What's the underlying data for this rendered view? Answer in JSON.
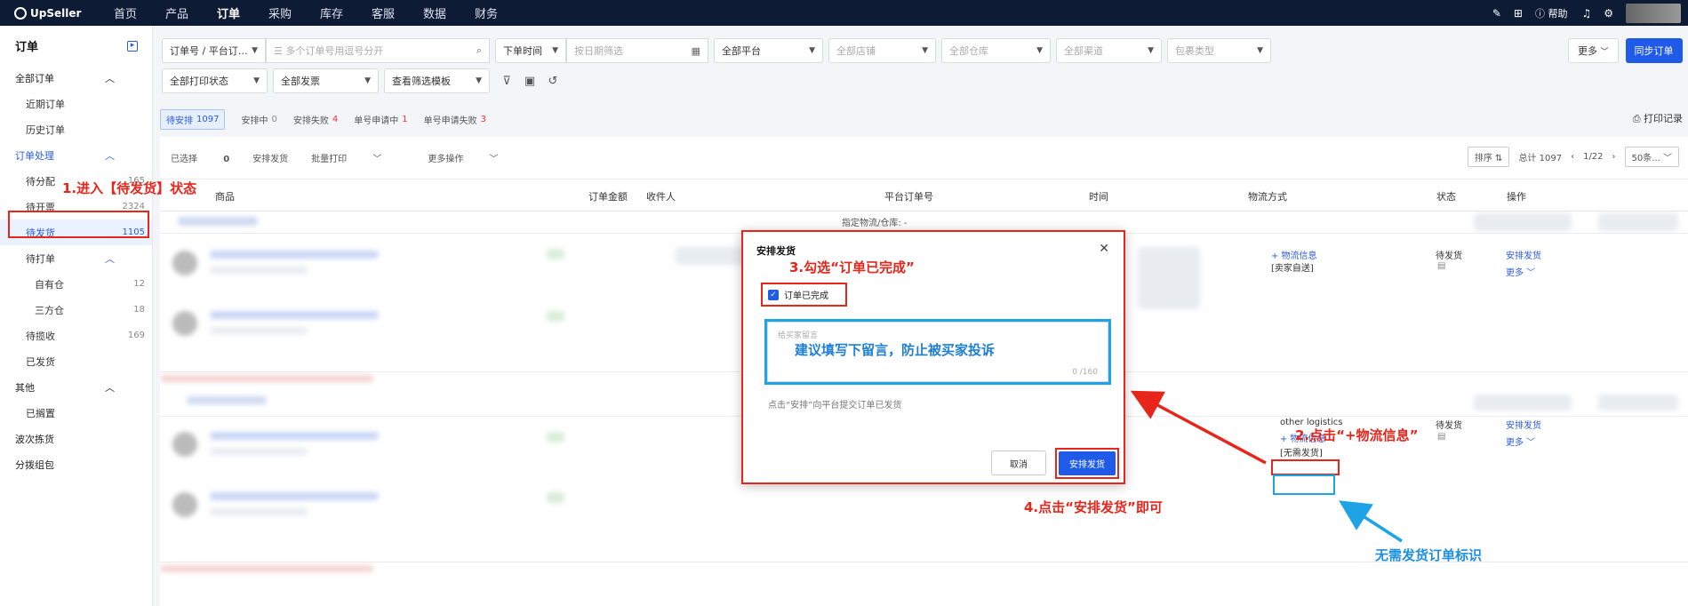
{
  "topbar": {
    "logo": "UpSeller",
    "nav": [
      "首页",
      "产品",
      "订单",
      "采购",
      "库存",
      "客服",
      "数据",
      "财务"
    ],
    "help": "帮助"
  },
  "sidebar": {
    "title": "订单",
    "all_orders": "全部订单",
    "recent": "近期订单",
    "history": "历史订单",
    "processing": "订单处理",
    "to_assign": {
      "label": "待分配",
      "count": "165"
    },
    "to_invoice": {
      "label": "待开票",
      "count": "2324"
    },
    "to_ship": {
      "label": "待发货",
      "count": "1105"
    },
    "to_print": {
      "label": "待打单"
    },
    "own_wh": {
      "label": "自有仓",
      "count": "12"
    },
    "third_wh": {
      "label": "三方仓",
      "count": "18"
    },
    "to_collect": {
      "label": "待揽收",
      "count": "169"
    },
    "shipped": "已发货",
    "other": "其他",
    "shelved": "已搁置",
    "wave": "波次拣货",
    "split": "分拨组包"
  },
  "filters": {
    "order_no_type": "订单号 / 平台订…",
    "order_no_placeholder": "多个订单号用逗号分开",
    "time_type": "下单时间",
    "date_placeholder": "按日期筛选",
    "platform": "全部平台",
    "store": "全部店铺",
    "warehouse": "全部仓库",
    "channel": "全部渠道",
    "package": "包裹类型",
    "print_status": "全部打印状态",
    "invoice": "全部发票",
    "template": "查看筛选模板",
    "more": "更多",
    "sync": "同步订单"
  },
  "tabs": [
    {
      "label": "待安排",
      "count": "1097"
    },
    {
      "label": "安排中",
      "count": "0"
    },
    {
      "label": "安排失败",
      "count": "4"
    },
    {
      "label": "单号申请中",
      "count": "1"
    },
    {
      "label": "单号申请失败",
      "count": "3"
    }
  ],
  "print_record": "打印记录",
  "toolbar": {
    "selected": "已选择",
    "selected_count": "0",
    "arrange": "安排发货",
    "batch_print": "批量打印",
    "more_ops": "更多操作",
    "sort": "排序",
    "total": "总计 1097",
    "page": "1/22",
    "per_page": "50条..."
  },
  "table_headers": [
    "商品",
    "订单金额",
    "收件人",
    "平台订单号",
    "时间",
    "物流方式",
    "状态",
    "操作"
  ],
  "rows_content": {
    "assigned_wh": "指定物流/仓库: -",
    "logistics_info": "+ 物流信息",
    "self_ship": "[卖家自送]",
    "other_logistics": "other logistics",
    "no_ship": "[无需发货]",
    "status": "待发货",
    "action": "安排发货",
    "more": "更多"
  },
  "modal": {
    "title": "安排发货",
    "checkbox_label": "订单已完成",
    "message_placeholder": "给买家留言",
    "message_counter": "0 /160",
    "hint": "点击“安排”向平台提交订单已发货",
    "cancel": "取消",
    "confirm": "安排发货"
  },
  "annotations": {
    "step1": "1.进入【待发货】状态",
    "step2": "2.点击“+物流信息”",
    "step3": "3.勾选“订单已完成”",
    "step4": "4.点击“安排发货”即可",
    "suggest": "建议填写下留言，防止被买家投诉",
    "no_ship_mark": "无需发货订单标识"
  },
  "colors": {
    "accent": "#1f5ae8",
    "annotation_red": "#e8251b",
    "annotation_blue": "#1ea4e6",
    "topbar": "#0d1b34"
  }
}
